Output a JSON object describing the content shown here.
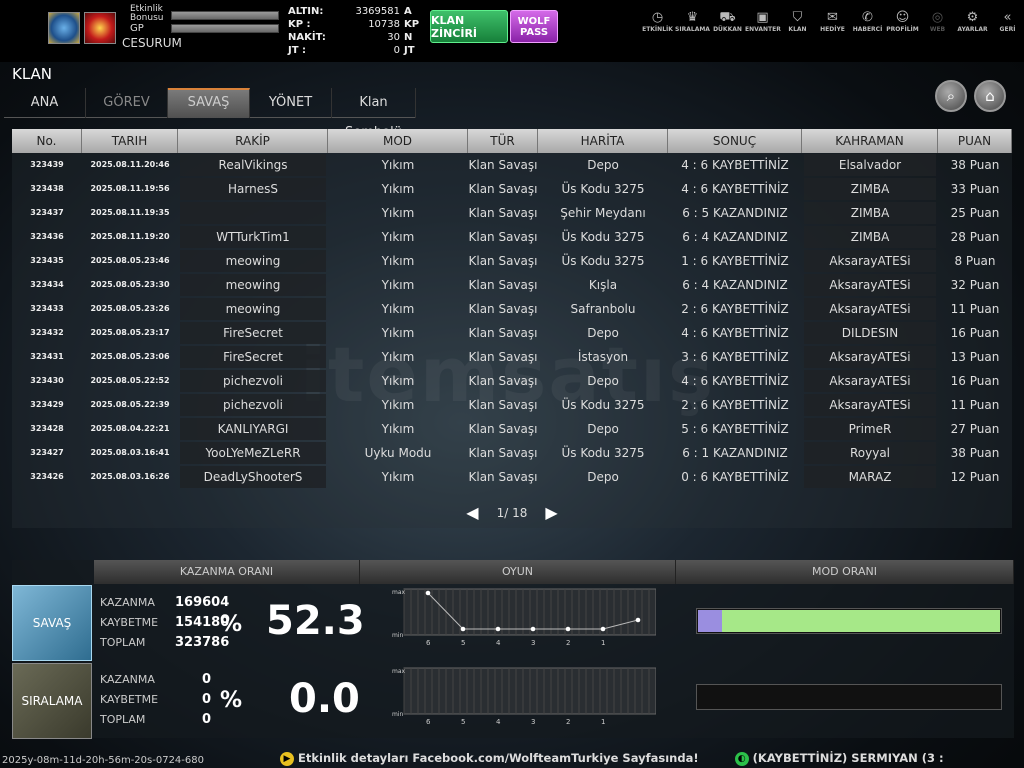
{
  "hud": {
    "event_bonus_label": "Etkinlik Bonusu",
    "gp_label": "GP",
    "player_name": "CESURUM",
    "currency": [
      {
        "label": "ALTIN:",
        "value": "3369581",
        "unit": "A"
      },
      {
        "label": "KP :",
        "value": "10738",
        "unit": "KP"
      },
      {
        "label": "NAKİT:",
        "value": "30",
        "unit": "N"
      },
      {
        "label": "JT :",
        "value": "0",
        "unit": "JT"
      }
    ],
    "chain_button": "KLAN ZİNCİRİ",
    "wolfpass_button": "WOLF PASS",
    "icons": [
      {
        "name": "event-icon",
        "glyph": "◷",
        "label": "ETKİNLİK",
        "enabled": true
      },
      {
        "name": "ranking-icon",
        "glyph": "♛",
        "label": "SIRALAMA",
        "enabled": true
      },
      {
        "name": "shop-icon",
        "glyph": "⛟",
        "label": "DÜKKAN",
        "enabled": true
      },
      {
        "name": "inventory-icon",
        "glyph": "▣",
        "label": "ENVANTER",
        "enabled": true
      },
      {
        "name": "clan-icon",
        "glyph": "⛉",
        "label": "KLAN",
        "enabled": true
      },
      {
        "name": "gift-icon",
        "glyph": "✉",
        "label": "HEDİYE",
        "enabled": true
      },
      {
        "name": "megaphone-icon",
        "glyph": "✆",
        "label": "HABERCİ",
        "enabled": true
      },
      {
        "name": "profile-icon",
        "glyph": "☺",
        "label": "PROFİLİM",
        "enabled": true
      },
      {
        "name": "web-icon",
        "glyph": "◎",
        "label": "WEB",
        "enabled": false
      },
      {
        "name": "settings-icon",
        "glyph": "⚙",
        "label": "AYARLAR",
        "enabled": true
      },
      {
        "name": "back-icon",
        "glyph": "«",
        "label": "GERİ",
        "enabled": true
      }
    ]
  },
  "page_title": "KLAN",
  "tabs": [
    {
      "label": "ANA",
      "state": "normal"
    },
    {
      "label": "GÖREV",
      "state": "dim"
    },
    {
      "label": "SAVAŞ",
      "state": "active"
    },
    {
      "label": "YÖNET",
      "state": "normal"
    },
    {
      "label": "Klan Sembolü",
      "state": "normal"
    }
  ],
  "table": {
    "columns": [
      "No.",
      "TARIH",
      "RAKİP",
      "MOD",
      "TÜR",
      "HARİTA",
      "SONUÇ",
      "KAHRAMAN",
      "PUAN"
    ],
    "rows": [
      [
        "323439",
        "2025.08.11.20:46",
        "RealVikings",
        "Yıkım",
        "Klan Savaşı",
        "Depo",
        "4 : 6 KAYBETTİNİZ",
        "Elsalvador",
        "38 Puan"
      ],
      [
        "323438",
        "2025.08.11.19:56",
        "HarnesS",
        "Yıkım",
        "Klan Savaşı",
        "Üs Kodu 3275",
        "4 : 6 KAYBETTİNİZ",
        "ZIMBA",
        "33 Puan"
      ],
      [
        "323437",
        "2025.08.11.19:35",
        "",
        "Yıkım",
        "Klan Savaşı",
        "Şehir Meydanı",
        "6 : 5 KAZANDINIZ",
        "ZIMBA",
        "25 Puan"
      ],
      [
        "323436",
        "2025.08.11.19:20",
        "WTTurkTim1",
        "Yıkım",
        "Klan Savaşı",
        "Üs Kodu 3275",
        "6 : 4 KAZANDINIZ",
        "ZIMBA",
        "28 Puan"
      ],
      [
        "323435",
        "2025.08.05.23:46",
        "meowing",
        "Yıkım",
        "Klan Savaşı",
        "Üs Kodu 3275",
        "1 : 6 KAYBETTİNİZ",
        "AksarayATESi",
        "8 Puan"
      ],
      [
        "323434",
        "2025.08.05.23:30",
        "meowing",
        "Yıkım",
        "Klan Savaşı",
        "Kışla",
        "6 : 4 KAZANDINIZ",
        "AksarayATESi",
        "32 Puan"
      ],
      [
        "323433",
        "2025.08.05.23:26",
        "meowing",
        "Yıkım",
        "Klan Savaşı",
        "Safranbolu",
        "2 : 6 KAYBETTİNİZ",
        "AksarayATESi",
        "11 Puan"
      ],
      [
        "323432",
        "2025.08.05.23:17",
        "FireSecret",
        "Yıkım",
        "Klan Savaşı",
        "Depo",
        "4 : 6 KAYBETTİNİZ",
        "DILDESIN",
        "16 Puan"
      ],
      [
        "323431",
        "2025.08.05.23:06",
        "FireSecret",
        "Yıkım",
        "Klan Savaşı",
        "İstasyon",
        "3 : 6 KAYBETTİNİZ",
        "AksarayATESi",
        "13 Puan"
      ],
      [
        "323430",
        "2025.08.05.22:52",
        "pichezvoli",
        "Yıkım",
        "Klan Savaşı",
        "Depo",
        "4 : 6 KAYBETTİNİZ",
        "AksarayATESi",
        "16 Puan"
      ],
      [
        "323429",
        "2025.08.05.22:39",
        "pichezvoli",
        "Yıkım",
        "Klan Savaşı",
        "Üs Kodu 3275",
        "2 : 6 KAYBETTİNİZ",
        "AksarayATESi",
        "11 Puan"
      ],
      [
        "323428",
        "2025.08.04.22:21",
        "KANLIYARGI",
        "Yıkım",
        "Klan Savaşı",
        "Depo",
        "5 : 6 KAYBETTİNİZ",
        "PrimeR",
        "27 Puan"
      ],
      [
        "323427",
        "2025.08.03.16:41",
        "YooLYeMeZLeRR",
        "Uyku Modu",
        "Klan Savaşı",
        "Üs Kodu 3275",
        "6 : 1 KAZANDINIZ",
        "Royyal",
        "38 Puan"
      ],
      [
        "323426",
        "2025.08.03.16:26",
        "DeadLyShooterS",
        "Yıkım",
        "Klan Savaşı",
        "Depo",
        "0 : 6 KAYBETTİNİZ",
        "MARAZ",
        "12 Puan"
      ]
    ]
  },
  "pager": {
    "text": "1/ 18"
  },
  "stats": {
    "headers": [
      "KAZANMA ORANI",
      "OYUN",
      "MOD ORANI"
    ],
    "savas": {
      "label": "SAVAŞ",
      "win_label": "KAZANMA",
      "win": "169604",
      "lose_label": "KAYBETME",
      "lose": "154180",
      "total_label": "TOPLAM",
      "total": "323786",
      "pct_sign": "%",
      "pct": "52.3",
      "mod_fill_fraction": 0.08,
      "mod_color_a": "#9a8ee0",
      "mod_color_b": "#a6e888"
    },
    "siralama": {
      "label": "SIRALAMA",
      "win_label": "KAZANMA",
      "win": "0",
      "lose_label": "KAYBETME",
      "lose": "0",
      "total_label": "TOPLAM",
      "total": "0",
      "pct_sign": "%",
      "pct": "0.0"
    },
    "graph_axis": {
      "max": "max",
      "min": "min",
      "x_ticks": [
        "6",
        "5",
        "4",
        "3",
        "2",
        "1"
      ]
    },
    "savas_graph_levels": [
      1.0,
      0.0,
      0.0,
      0.0,
      0.0,
      0.0,
      0.25
    ],
    "siralama_graph_levels": [
      0,
      0,
      0,
      0,
      0,
      0,
      0
    ]
  },
  "footer": {
    "timestamp": "2025y-08m-11d-20h-56m-20s-0724-680",
    "ticker_1": "Etkinlik detayları Facebook.com/WolfteamTurkiye Sayfasında!",
    "ticker_2": "(KAYBETTİNİZ) SERMIYAN (3 :"
  },
  "watermark": "itemsatış"
}
